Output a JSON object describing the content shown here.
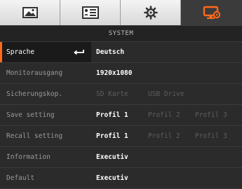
{
  "colors": {
    "accent": "#ff6a1a",
    "active_tab_bg": "#3b3b3b",
    "tab_bg": "#e6e6e6",
    "menu_bg": "#2b2b2b",
    "value_active": "#ffffff",
    "value_disabled": "#5e5e5e"
  },
  "tabs": [
    {
      "icon": "image-icon",
      "active": false
    },
    {
      "icon": "settings-card-icon",
      "active": false
    },
    {
      "icon": "gear-icon",
      "active": false
    },
    {
      "icon": "monitor-settings-icon",
      "active": true
    }
  ],
  "section_title": "SYSTEM",
  "rows": {
    "sprache": {
      "label": "Sprache",
      "icon": "enter-arrow-icon",
      "value": "Deutsch"
    },
    "monitor": {
      "label": "Monitorausgang",
      "value": "1920x1080"
    },
    "backup": {
      "label": "Sicherungskop.",
      "options": [
        "SD Karte",
        "USB Drive"
      ]
    },
    "save": {
      "label": "Save setting",
      "options": [
        "Profil 1",
        "Profil 2",
        "Profil 3"
      ]
    },
    "recall": {
      "label": "Recall setting",
      "options": [
        "Profil 1",
        "Profil 2",
        "Profil 3"
      ]
    },
    "information": {
      "label": "Information",
      "value": "Executiv"
    },
    "default": {
      "label": "Default",
      "value": "Executiv"
    }
  }
}
